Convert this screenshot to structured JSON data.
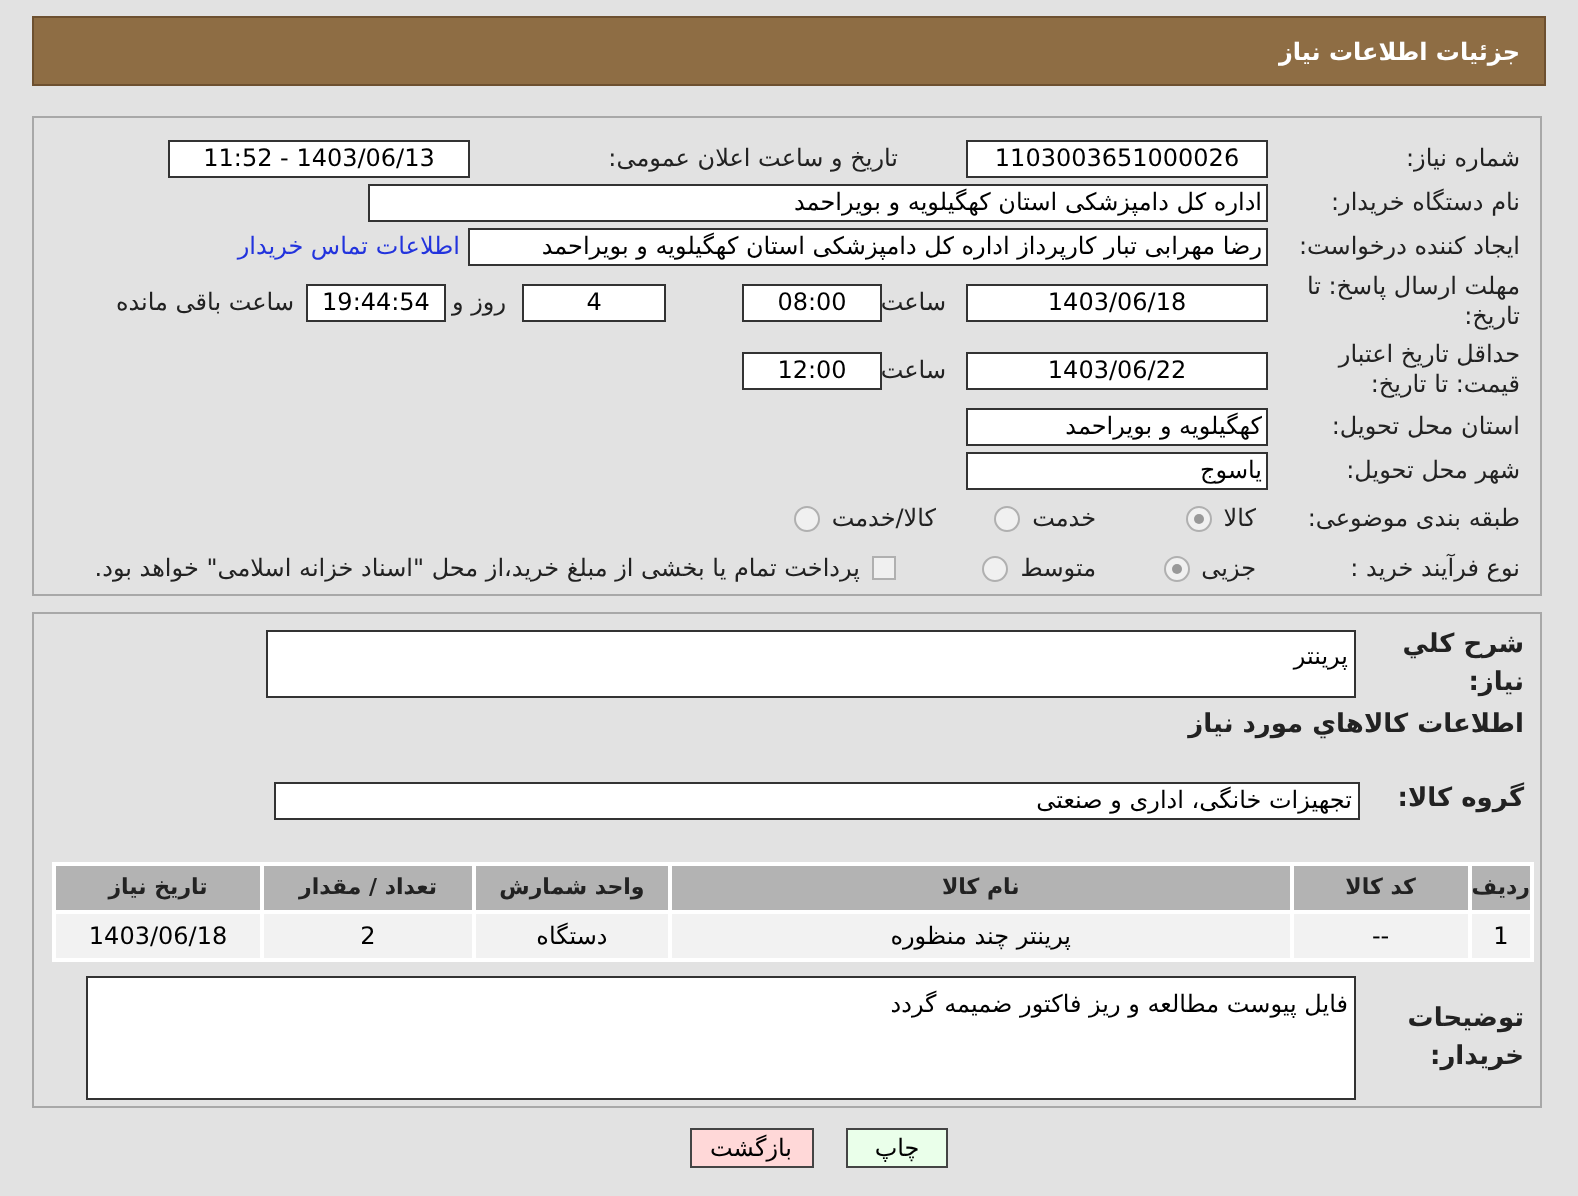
{
  "header": {
    "title": "جزئیات اطلاعات نیاز"
  },
  "need_number": {
    "label": "شماره نیاز:",
    "value": "1103003651000026"
  },
  "announce": {
    "label": "تاریخ و ساعت اعلان عمومی:",
    "value": "1403/06/13 - 11:52"
  },
  "buyer_org": {
    "label": "نام دستگاه خریدار:",
    "value": "اداره کل دامپزشکی استان کهگیلویه و بویراحمد"
  },
  "requester": {
    "label": "ایجاد کننده درخواست:",
    "value": "رضا مهرابی تبار کارپرداز اداره کل دامپزشکی استان کهگیلویه و بویراحمد",
    "link": "اطلاعات تماس خریدار"
  },
  "response_deadline": {
    "label": "مهلت ارسال پاسخ: تا تاریخ:",
    "date": "1403/06/18",
    "time_label": "ساعت",
    "time": "08:00",
    "days": "4",
    "days_label": "روز و",
    "remaining": "19:44:54",
    "remaining_label": "ساعت باقی مانده"
  },
  "price_validity": {
    "label": "حداقل تاریخ اعتبار قیمت: تا تاریخ:",
    "date": "1403/06/22",
    "time_label": "ساعت",
    "time": "12:00"
  },
  "province": {
    "label": "استان محل تحویل:",
    "value": "کهگیلویه و بویراحمد"
  },
  "city": {
    "label": "شهر محل تحویل:",
    "value": "یاسوج"
  },
  "category": {
    "label": "طبقه بندی موضوعی:",
    "options": [
      {
        "label": "کالا",
        "selected": true
      },
      {
        "label": "خدمت",
        "selected": false
      },
      {
        "label": "کالا/خدمت",
        "selected": false
      }
    ]
  },
  "process": {
    "label": "نوع فرآیند خرید :",
    "options": [
      {
        "label": "جزیی",
        "selected": true
      },
      {
        "label": "متوسط",
        "selected": false
      }
    ],
    "payment": {
      "checked": false,
      "label": "پرداخت تمام یا بخشی از مبلغ خرید،از محل \"اسناد خزانه اسلامی\" خواهد بود."
    }
  },
  "description": {
    "label": "شرح کلي نياز:",
    "value": "پرینتر"
  },
  "goods_title": "اطلاعات کالاهاي مورد نياز",
  "goods_group": {
    "label": "گروه کالا:",
    "value": "تجهیزات خانگی، اداری و صنعتی"
  },
  "table": {
    "columns": [
      "ردیف",
      "کد کالا",
      "نام کالا",
      "واحد شمارش",
      "تعداد / مقدار",
      "تاریخ نیاز"
    ],
    "rows": [
      [
        "1",
        "--",
        "پرینتر چند منظوره",
        "دستگاه",
        "2",
        "1403/06/18"
      ]
    ]
  },
  "buyer_notes": {
    "label": "توضیحات خریدار:",
    "value": "فایل پیوست مطالعه و ریز فاکتور ضمیمه گردد"
  },
  "buttons": [
    {
      "label": "چاپ",
      "kind": "print"
    },
    {
      "label": "بازگشت",
      "kind": "back"
    }
  ]
}
